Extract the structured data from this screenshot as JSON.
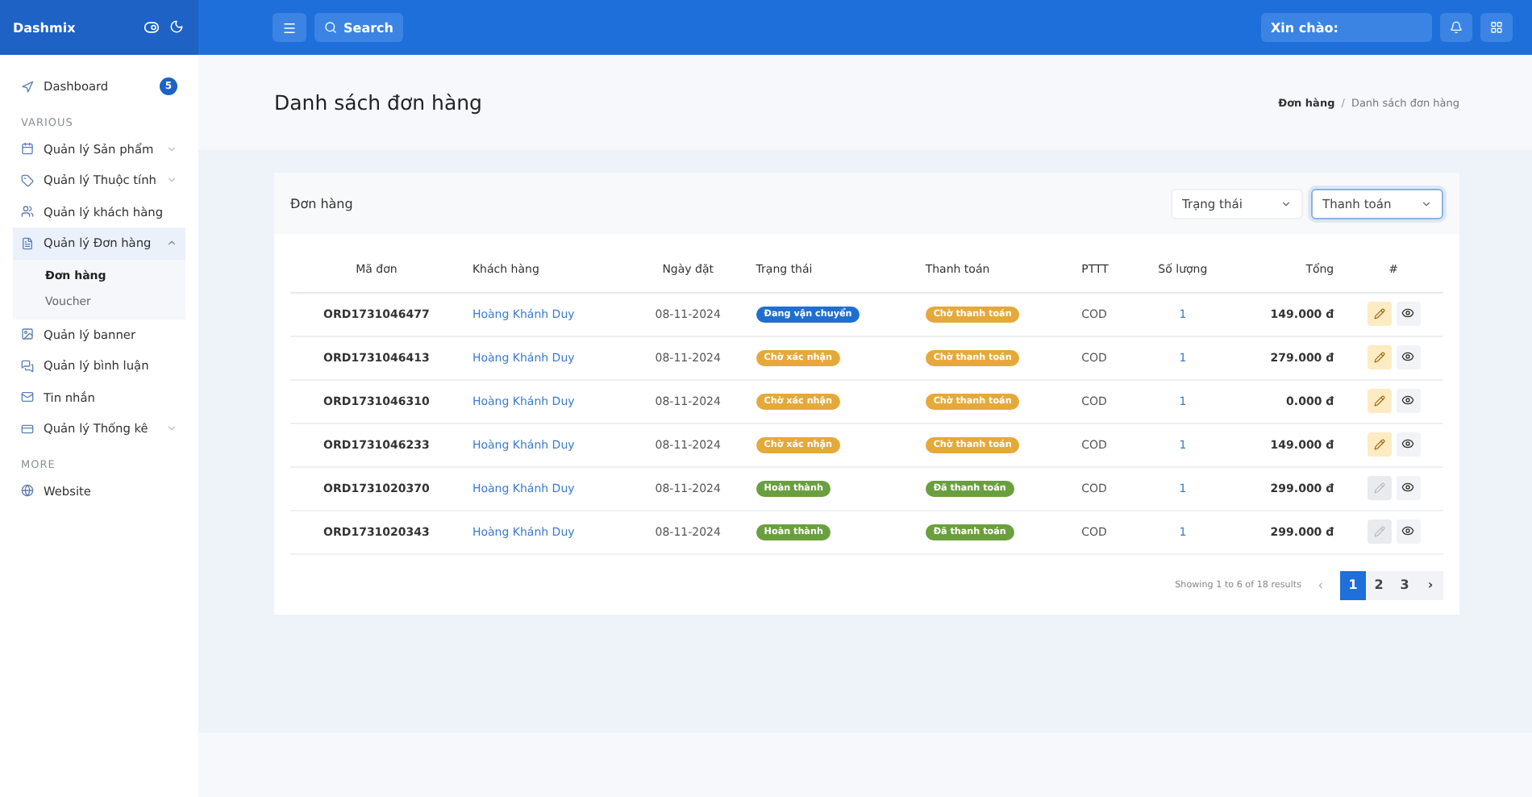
{
  "sidebar": {
    "brand": "Dashmix",
    "items": [
      {
        "kind": "link",
        "label": "Dashboard",
        "badge": "5",
        "selected": false
      },
      {
        "kind": "heading",
        "label": "VARIOUS"
      },
      {
        "kind": "link",
        "label": "Quản lý Sản phẩm",
        "expanded": false,
        "selected": false
      },
      {
        "kind": "link",
        "label": "Quản lý Thuộc tính",
        "expanded": false,
        "selected": false
      },
      {
        "kind": "link",
        "label": "Quản lý khách hàng",
        "selected": false
      },
      {
        "kind": "link",
        "label": "Quản lý Đơn hàng",
        "expanded": true,
        "selected": true,
        "children": [
          {
            "label": "Đơn hàng",
            "selected": true
          },
          {
            "label": "Voucher",
            "selected": false
          }
        ]
      },
      {
        "kind": "link",
        "label": "Quản lý banner",
        "selected": false
      },
      {
        "kind": "link",
        "label": "Quản lý bình luận",
        "selected": false
      },
      {
        "kind": "link",
        "label": "Tin nhắn",
        "selected": false
      },
      {
        "kind": "link",
        "label": "Quản lý Thống kê",
        "expanded": false,
        "selected": false
      },
      {
        "kind": "heading",
        "label": "MORE"
      },
      {
        "kind": "link",
        "label": "Website",
        "selected": false
      }
    ]
  },
  "header": {
    "search": "Search",
    "greeting": "Xin chào:"
  },
  "page": {
    "title": "Danh sách đơn hàng",
    "breadcrumb": [
      "Đơn hàng",
      "Danh sách đơn hàng"
    ],
    "separator": "/"
  },
  "card": {
    "title": "Đơn hàng",
    "filters": [
      {
        "label": "Trạng thái",
        "selected": false
      },
      {
        "label": "Thanh toán",
        "selected": true
      }
    ]
  },
  "table": {
    "columns": [
      "Mã đơn",
      "Khách hàng",
      "Ngày đặt",
      "Trạng thái",
      "Thanh toán",
      "PTTT",
      "Số lượng",
      "Tổng",
      "#"
    ],
    "rows": [
      {
        "id": "ORD1731046477",
        "customer": "Hoàng Khánh Duy",
        "date": "08-11-2024",
        "status": {
          "label": "Đang vận chuyển",
          "color": "#1f6fd1"
        },
        "payment": {
          "label": "Chờ thanh toán",
          "color": "#e5a93a"
        },
        "method": "COD",
        "qty": "1",
        "total": "149.000 đ",
        "editable": true
      },
      {
        "id": "ORD1731046413",
        "customer": "Hoàng Khánh Duy",
        "date": "08-11-2024",
        "status": {
          "label": "Chờ xác nhận",
          "color": "#e5a93a"
        },
        "payment": {
          "label": "Chờ thanh toán",
          "color": "#e5a93a"
        },
        "method": "COD",
        "qty": "1",
        "total": "279.000 đ",
        "editable": true
      },
      {
        "id": "ORD1731046310",
        "customer": "Hoàng Khánh Duy",
        "date": "08-11-2024",
        "status": {
          "label": "Chờ xác nhận",
          "color": "#e5a93a"
        },
        "payment": {
          "label": "Chờ thanh toán",
          "color": "#e5a93a"
        },
        "method": "COD",
        "qty": "1",
        "total": "0.000 đ",
        "editable": true
      },
      {
        "id": "ORD1731046233",
        "customer": "Hoàng Khánh Duy",
        "date": "08-11-2024",
        "status": {
          "label": "Chờ xác nhận",
          "color": "#e5a93a"
        },
        "payment": {
          "label": "Chờ thanh toán",
          "color": "#e5a93a"
        },
        "method": "COD",
        "qty": "1",
        "total": "149.000 đ",
        "editable": true
      },
      {
        "id": "ORD1731020370",
        "customer": "Hoàng Khánh Duy",
        "date": "08-11-2024",
        "status": {
          "label": "Hoàn thành",
          "color": "#6a9f3e"
        },
        "payment": {
          "label": "Đã thanh toán",
          "color": "#6a9f3e"
        },
        "method": "COD",
        "qty": "1",
        "total": "299.000 đ",
        "editable": false
      },
      {
        "id": "ORD1731020343",
        "customer": "Hoàng Khánh Duy",
        "date": "08-11-2024",
        "status": {
          "label": "Hoàn thành",
          "color": "#6a9f3e"
        },
        "payment": {
          "label": "Đã thanh toán",
          "color": "#6a9f3e"
        },
        "method": "COD",
        "qty": "1",
        "total": "299.000 đ",
        "editable": false
      }
    ]
  },
  "pagination": {
    "summary": "Showing 1 to 6 of 18 results",
    "prev": "‹",
    "next": "›",
    "pages": [
      {
        "label": "1",
        "selected": true
      },
      {
        "label": "2",
        "selected": false
      },
      {
        "label": "3",
        "selected": false
      }
    ]
  }
}
